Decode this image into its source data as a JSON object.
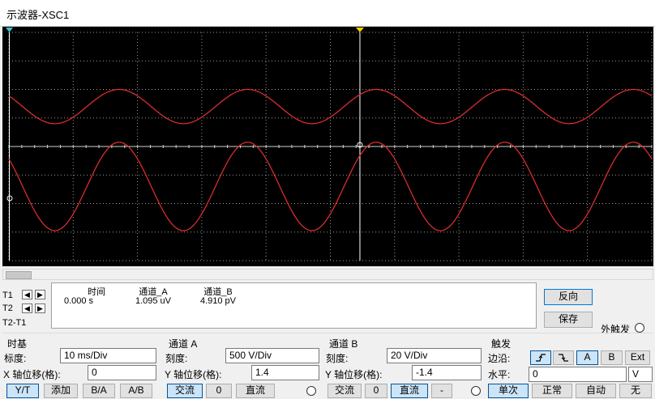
{
  "window": {
    "title": "示波器-XSC1"
  },
  "readout": {
    "rows": [
      "T1",
      "T2",
      "T2-T1"
    ],
    "headers": {
      "time": "时间",
      "chA": "通道_A",
      "chB": "通道_B"
    },
    "values": {
      "time": "0.000 s",
      "chA": "1.095 uV",
      "chB": "4.910 pV"
    }
  },
  "side": {
    "reverse": "反向",
    "save": "保存",
    "ext_trigger": "外触发"
  },
  "timebase": {
    "title": "时基",
    "scale_label": "标度:",
    "scale": "10 ms/Div",
    "xpos_label": "X 轴位移(格):",
    "xpos": "0",
    "modes": [
      "Y/T",
      "添加",
      "B/A",
      "A/B"
    ]
  },
  "channel_a": {
    "title": "通道 A",
    "scale_label": "刻度:",
    "scale": "500  V/Div",
    "ypos_label": "Y 轴位移(格):",
    "ypos": "1.4",
    "coupling": [
      "交流",
      "0",
      "直流"
    ]
  },
  "channel_b": {
    "title": "通道 B",
    "scale_label": "刻度:",
    "scale": "20  V/Div",
    "ypos_label": "Y 轴位移(格):",
    "ypos": "-1.4",
    "coupling": [
      "交流",
      "0",
      "直流",
      "-"
    ]
  },
  "trigger": {
    "title": "触发",
    "edge_label": "边沿:",
    "level_label": "水平:",
    "level": "0",
    "level_unit": "V",
    "sources": [
      "A",
      "B",
      "Ext"
    ],
    "modes": [
      "单次",
      "正常",
      "自动",
      "无"
    ]
  },
  "chart_data": {
    "type": "line",
    "grid": true,
    "divisions": {
      "x": 10,
      "y": 8
    },
    "series": [
      {
        "color": "#e83030",
        "center_div": 1.4,
        "amplitude_div": 0.6,
        "cycles": 5,
        "phase": 0.0
      },
      {
        "color": "#e83030",
        "center_div": -1.4,
        "amplitude_div": 1.55,
        "cycles": 5,
        "phase": 0.0
      }
    ]
  },
  "colors": {
    "trace": "#e83030",
    "screen_bg": "#000000",
    "grid": "#9a9a9a",
    "cursor": "#ffffff"
  }
}
